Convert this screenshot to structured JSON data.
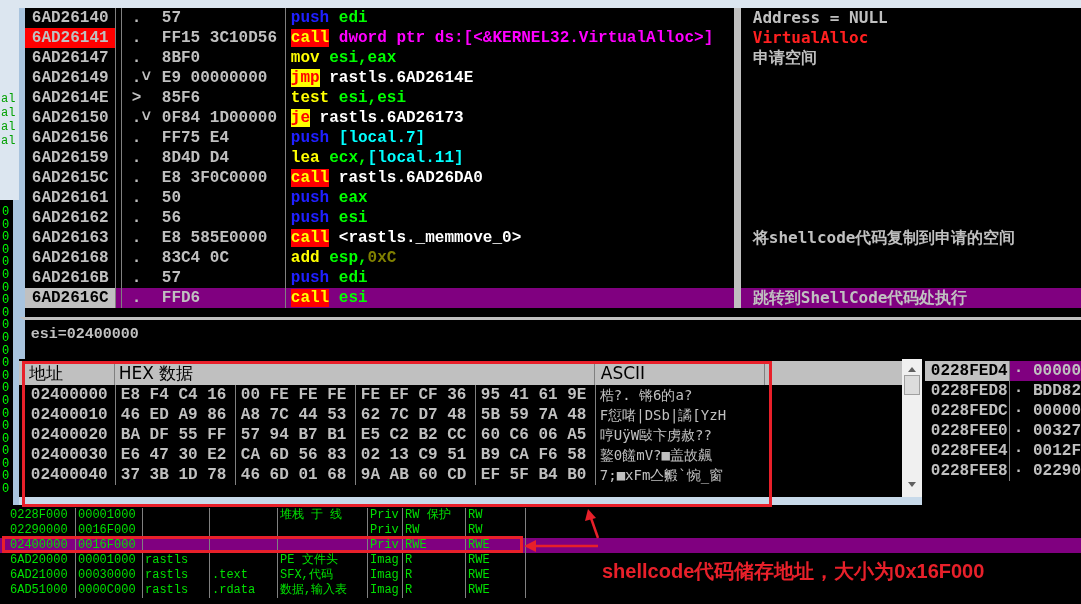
{
  "left_strip": {
    "tags": [
      "al",
      "al",
      "al",
      "al"
    ],
    "digits": [
      "0",
      "0",
      "0",
      "0",
      "0",
      "0",
      "0",
      "0",
      "0",
      "0",
      "0",
      "0",
      "0",
      "0",
      "0",
      "0",
      "0",
      "0",
      "0",
      "0",
      "0",
      "0",
      "0"
    ]
  },
  "disassembly": {
    "rows": [
      {
        "address": "6AD26140",
        "breakpoint": false,
        "selected": false,
        "marker": ".",
        "bytes": "57",
        "kind": "push",
        "mnemonic": "push",
        "operands": [
          {
            "text": "edi",
            "kind": "reg"
          }
        ],
        "comment": {
          "text": "Address = NULL",
          "kind": "note"
        }
      },
      {
        "address": "6AD26141",
        "breakpoint": true,
        "selected": false,
        "marker": ".",
        "bytes": "FF15 3C10D56",
        "kind": "call",
        "mnemonic": "call",
        "operands": [
          {
            "text": "dword ptr ds:[<&KERNEL32.VirtualAlloc>]",
            "kind": "api"
          }
        ],
        "comment": {
          "text": "VirtualAlloc",
          "kind": "api"
        }
      },
      {
        "address": "6AD26147",
        "breakpoint": false,
        "selected": false,
        "marker": ".",
        "bytes": "8BF0",
        "kind": "plain",
        "mnemonic": "mov",
        "operands": [
          {
            "text": "esi,eax",
            "kind": "reg"
          }
        ],
        "comment": {
          "text": "申请空间",
          "kind": "note"
        }
      },
      {
        "address": "6AD26149",
        "breakpoint": false,
        "selected": false,
        "marker": ".˅",
        "bytes": "E9 00000000",
        "kind": "jump",
        "mnemonic": "jmp",
        "operands": [
          {
            "text": "rastls.6AD2614E",
            "kind": "label"
          }
        ]
      },
      {
        "address": "6AD2614E",
        "breakpoint": false,
        "selected": false,
        "marker": ">",
        "bytes": "85F6",
        "kind": "plain",
        "mnemonic": "test",
        "operands": [
          {
            "text": "esi,esi",
            "kind": "reg"
          }
        ]
      },
      {
        "address": "6AD26150",
        "breakpoint": false,
        "selected": false,
        "marker": ".˅",
        "bytes": "0F84 1D00000",
        "kind": "jump",
        "mnemonic": "je",
        "operands": [
          {
            "text": "rastls.6AD26173",
            "kind": "label"
          }
        ]
      },
      {
        "address": "6AD26156",
        "breakpoint": false,
        "selected": false,
        "marker": ".",
        "bytes": "FF75 E4",
        "kind": "push",
        "mnemonic": "push",
        "operands": [
          {
            "text": "[local.7]",
            "kind": "local"
          }
        ]
      },
      {
        "address": "6AD26159",
        "breakpoint": false,
        "selected": false,
        "marker": ".",
        "bytes": "8D4D D4",
        "kind": "plain",
        "mnemonic": "lea",
        "operands": [
          {
            "text": "ecx,",
            "kind": "reg"
          },
          {
            "text": "[local.11]",
            "kind": "local"
          }
        ]
      },
      {
        "address": "6AD2615C",
        "breakpoint": false,
        "selected": false,
        "marker": ".",
        "bytes": "E8 3F0C0000",
        "kind": "call",
        "mnemonic": "call",
        "operands": [
          {
            "text": "rastls.6AD26DA0",
            "kind": "label"
          }
        ]
      },
      {
        "address": "6AD26161",
        "breakpoint": false,
        "selected": false,
        "marker": ".",
        "bytes": "50",
        "kind": "push",
        "mnemonic": "push",
        "operands": [
          {
            "text": "eax",
            "kind": "reg"
          }
        ]
      },
      {
        "address": "6AD26162",
        "breakpoint": false,
        "selected": false,
        "marker": ".",
        "bytes": "56",
        "kind": "push",
        "mnemonic": "push",
        "operands": [
          {
            "text": "esi",
            "kind": "reg"
          }
        ]
      },
      {
        "address": "6AD26163",
        "breakpoint": false,
        "selected": false,
        "marker": ".",
        "bytes": "E8 585E0000",
        "kind": "call",
        "mnemonic": "call",
        "operands": [
          {
            "text": "<rastls._memmove_0>",
            "kind": "label"
          }
        ],
        "comment": {
          "text": "将shellcode代码复制到申请的空间",
          "kind": "note"
        }
      },
      {
        "address": "6AD26168",
        "breakpoint": false,
        "selected": false,
        "marker": ".",
        "bytes": "83C4 0C",
        "kind": "plain",
        "mnemonic": "add",
        "operands": [
          {
            "text": "esp,",
            "kind": "reg"
          },
          {
            "text": "0xC",
            "kind": "const"
          }
        ]
      },
      {
        "address": "6AD2616B",
        "breakpoint": false,
        "selected": false,
        "marker": ".",
        "bytes": "57",
        "kind": "push",
        "mnemonic": "push",
        "operands": [
          {
            "text": "edi",
            "kind": "reg"
          }
        ]
      },
      {
        "address": "6AD2616C",
        "breakpoint": false,
        "selected": true,
        "marker": ".",
        "bytes": "FFD6",
        "kind": "call",
        "mnemonic": "call",
        "operands": [
          {
            "text": "esi",
            "kind": "reg"
          }
        ],
        "comment": {
          "text": "跳转到ShellCode代码处执行",
          "kind": "note"
        }
      }
    ]
  },
  "info_line": "esi=02400000",
  "hex_dump": {
    "columns": [
      "地址",
      "HEX 数据",
      "ASCII"
    ],
    "rows": [
      {
        "address": "02400000",
        "groups": [
          "E8 F4 C4 16",
          "00 FE FE FE",
          "FE EF CF 36",
          "95 41 61 9E"
        ],
        "ascii": "梏?.    锵6的a?"
      },
      {
        "address": "02400010",
        "groups": [
          "46 ED A9 86",
          "A8 7C 44 53",
          "62 7C D7 48",
          "5B 59 7A 48"
        ],
        "ascii": "F愆啫|DSb|譎[YzH"
      },
      {
        "address": "02400020",
        "groups": [
          "BA DF 55 FF",
          "57 94 B7 B1",
          "E5 C2 B2 CC",
          "60 C6 06 A5"
        ],
        "ascii": "哼UÿW敺卞虏赦??"
      },
      {
        "address": "02400030",
        "groups": [
          "E6 47 30 E2",
          "CA 6D 56 83",
          "02 13 C9 51",
          "B9 CA F6 58"
        ],
        "ascii": "鐜0饈mV?■盖故飆"
      },
      {
        "address": "02400040",
        "groups": [
          "37 3B 1D 78",
          "46 6D 01 68",
          "9A AB 60 CD",
          "EF 5F B4 B0"
        ],
        "ascii": "7;■xFm亼毈`惋_窗"
      }
    ]
  },
  "stack": {
    "rows": [
      {
        "address": "0228FED4",
        "value": "· 00000",
        "selected": true
      },
      {
        "address": "0228FED8",
        "value": "· BDD82",
        "selected": false
      },
      {
        "address": "0228FEDC",
        "value": "· 00000",
        "selected": false
      },
      {
        "address": "0228FEE0",
        "value": "· 00327",
        "selected": false
      },
      {
        "address": "0228FEE4",
        "value": "· 0012F",
        "selected": false
      },
      {
        "address": "0228FEE8",
        "value": "· 02290",
        "selected": false
      }
    ]
  },
  "memory_map": {
    "rows": [
      {
        "selected": false,
        "column_1": "0228F000",
        "column_2": "00001000",
        "column_5": "堆栈 于 线",
        "column_6": "Priv",
        "column_7": "RW  保护",
        "column_8": "RW"
      },
      {
        "selected": false,
        "column_1": "02290000",
        "column_2": "0016F000",
        "column_6": "Priv",
        "column_7": "RW",
        "column_8": "RW"
      },
      {
        "selected": true,
        "column_1": "02400000",
        "column_2": "0016F000",
        "column_6": "Priv",
        "column_7": "RWE",
        "column_8": "RWE"
      },
      {
        "selected": false,
        "column_1": "6AD20000",
        "column_2": "00001000",
        "column_3": "rastls",
        "column_5": "PE 文件头",
        "column_6": "Imag",
        "column_7": "R",
        "column_8": "RWE"
      },
      {
        "selected": false,
        "column_1": "6AD21000",
        "column_2": "00030000",
        "column_3": "rastls",
        "column_4": ".text",
        "column_5": "SFX,代码",
        "column_6": "Imag",
        "column_7": "R",
        "column_8": "RWE"
      },
      {
        "selected": false,
        "column_1": "6AD51000",
        "column_2": "0000C000",
        "column_3": "rastls",
        "column_4": ".rdata",
        "column_5": "数据,输入表",
        "column_6": "Imag",
        "column_7": "R",
        "column_8": "RWE"
      }
    ]
  },
  "annotation": {
    "label": "shellcode代码储存地址，大小为0x16F000"
  }
}
